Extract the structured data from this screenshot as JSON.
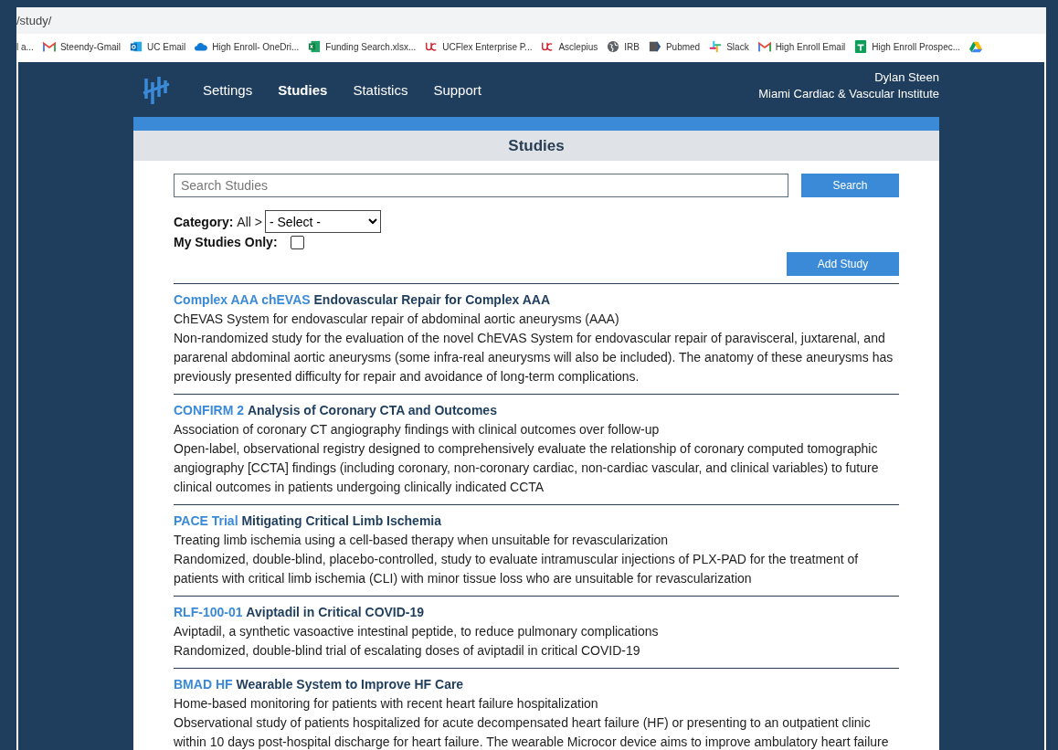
{
  "browser": {
    "address": "/study/",
    "bookmarks": [
      {
        "kind": "none",
        "label": "l a..."
      },
      {
        "kind": "gmail",
        "label": "Steendy-Gmail"
      },
      {
        "kind": "outlook",
        "label": "UC Email"
      },
      {
        "kind": "cloud",
        "label": "High Enroll- OneDri..."
      },
      {
        "kind": "excel",
        "label": "Funding Search.xlsx..."
      },
      {
        "kind": "uc",
        "label": "UCFlex Enterprise P..."
      },
      {
        "kind": "uc",
        "label": "Asclepius"
      },
      {
        "kind": "globe",
        "label": "IRB"
      },
      {
        "kind": "pubmed",
        "label": "Pubmed"
      },
      {
        "kind": "slack",
        "label": "Slack"
      },
      {
        "kind": "gmail",
        "label": "High Enroll Email"
      },
      {
        "kind": "sheets",
        "label": "High Enroll Prospec..."
      },
      {
        "kind": "drive"
      }
    ]
  },
  "nav": [
    {
      "label": "Settings",
      "selected": false
    },
    {
      "label": "Studies",
      "selected": true
    },
    {
      "label": "Statistics",
      "selected": false
    },
    {
      "label": "Support",
      "selected": false
    }
  ],
  "user": {
    "name": "Dylan Steen",
    "organization": "Miami Cardiac & Vascular Institute"
  },
  "page_title": "Studies",
  "search": {
    "placeholder": "Search Studies",
    "button": "Search"
  },
  "category": {
    "label": "Category:",
    "path": "All >",
    "select": "- Select -"
  },
  "my_studies": {
    "label": "My Studies Only:",
    "checked": false
  },
  "add_button": "Add Study",
  "studies": [
    {
      "code": "Complex AAA chEVAS",
      "title": "Endovascular Repair for Complex AAA",
      "summary": "ChEVAS System for endovascular repair of abdominal aortic aneurysms (AAA)",
      "description": "Non-randomized study for the evaluation of the novel ChEVAS System for endovascular repair of paravisceral, juxtarenal, and pararenal abdominal aortic aneurysms (some infra-real aneurysms will also be included). The anatomy of these aneurysms has previously presented difficulty for repair and avoidance of long-term complications."
    },
    {
      "code": "CONFIRM 2",
      "title": "Analysis of Coronary CTA and Outcomes",
      "summary": "Association of coronary CT angiography findings with clinical outcomes over follow-up",
      "description": "Open-label, observational registry designed to comprehensively evaluate the relationship of coronary computed tomographic angiography [CCTA] findings (including coronary, non-coronary cardiac, non-cardiac vascular, and clinical variables) to future clinical outcomes in patients undergoing clinically indicated CCTA"
    },
    {
      "code": "PACE Trial",
      "title": "Mitigating Critical Limb Ischemia",
      "summary": "Treating limb ischemia using a cell-based therapy when unsuitable for revascularization",
      "description": "Randomized, double-blind, placebo-controlled, study to evaluate intramuscular injections of PLX-PAD for the treatment of patients with critical limb ischemia (CLI) with minor tissue loss who are unsuitable for revascularization"
    },
    {
      "code": "RLF-100-01",
      "title": "Aviptadil in Critical COVID-19",
      "summary": "Aviptadil, a synthetic vasoactive intestinal peptide, to reduce pulmonary complications",
      "description": "Randomized, double-blind trial of escalating doses of aviptadil in critical COVID-19"
    },
    {
      "code": "BMAD HF",
      "title": "Wearable System to Improve HF Care",
      "summary": "Home-based monitoring for patients with recent heart failure hospitalization",
      "description": "Observational study of patients hospitalized for acute decompensated heart failure (HF) or presenting to an outpatient clinic within 10 days post-hospital discharge for heart failure. The wearable Microcor device aims to improve ambulatory heart failure"
    }
  ]
}
